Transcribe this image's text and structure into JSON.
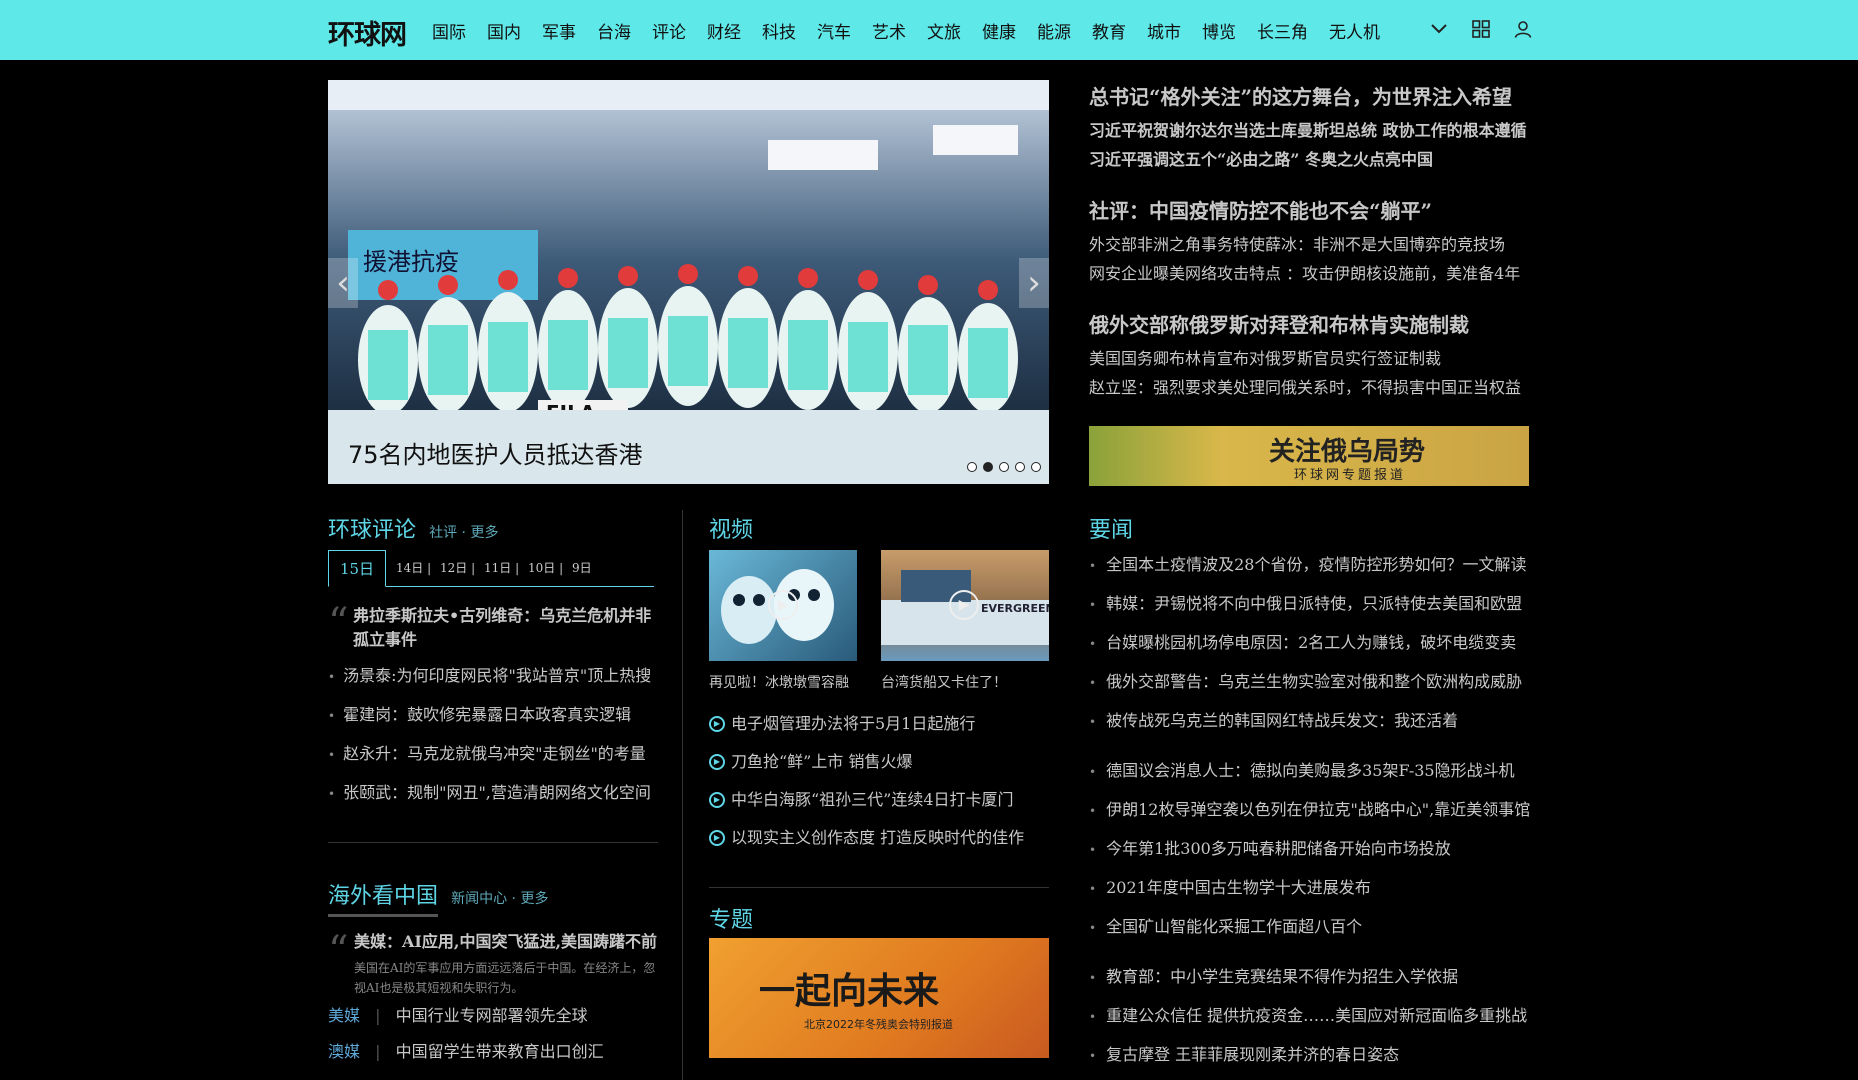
{
  "header": {
    "logo": "环球网",
    "nav": [
      "国际",
      "国内",
      "军事",
      "台海",
      "评论",
      "财经",
      "科技",
      "汽车",
      "艺术",
      "文旅",
      "健康",
      "能源",
      "教育",
      "城市",
      "博览",
      "长三角",
      "无人机"
    ]
  },
  "hero": {
    "caption": "75名内地医护人员抵达香港",
    "sign_text": "援港抗疫",
    "brand_text": "FILA",
    "prev": "‹",
    "next": "›",
    "active_slide": 2,
    "slides": 5
  },
  "headlines": [
    {
      "main": "总书记“格外关注”的这方舞台，为世界注入希望",
      "subs": [
        "习近平祝贺谢尔达尔当选土库曼斯坦总统 政协工作的根本遵循",
        "习近平强调这五个“必由之路” 冬奥之火点亮中国"
      ],
      "bold_subs": true
    },
    {
      "main": "社评：中国疫情防控不能也不会“躺平”",
      "subs": [
        "外交部非洲之角事务特使薛冰：非洲不是大国博弈的竞技场",
        "网安企业曝美网络攻击特点 ：攻击伊朗核设施前，美准备4年"
      ],
      "bold_subs": false
    },
    {
      "main": "俄外交部称俄罗斯对拜登和布林肯实施制裁",
      "subs": [
        "美国国务卿布林肯宣布对俄罗斯官员实行签证制裁",
        "赵立坚：强烈要求美处理同俄关系时，不得损害中国正当权益"
      ],
      "bold_subs": false
    }
  ],
  "banner": {
    "title": "关注俄乌局势",
    "subtitle": "环球网专题报道"
  },
  "commentary": {
    "title": "环球评论",
    "links": "社评 · 更多",
    "tabs": [
      "15日",
      "14日 |",
      "12日 |",
      "11日 |",
      "10日 |",
      "9日"
    ],
    "lead": "弗拉季斯拉夫•古列维奇：乌克兰危机并非孤立事件",
    "items": [
      "汤景泰:为何印度网民将\"我站普京\"顶上热搜",
      "霍建岗：鼓吹修宪暴露日本政客真实逻辑",
      "赵永升：马克龙就俄乌冲突\"走钢丝\"的考量",
      "张颐武：规制\"网丑\",营造清朗网络文化空间"
    ]
  },
  "overseas": {
    "title": "海外看中国",
    "links": "新闻中心 · 更多",
    "lead": "美媒：AI应用,中国突飞猛进,美国踌躇不前",
    "lead_desc": "美国在AI的军事应用方面远远落后于中国。在经济上，忽视AI也是极其短视和失职行为。",
    "rows": [
      {
        "tag": "美媒",
        "text": "中国行业专网部署领先全球"
      },
      {
        "tag": "澳媒",
        "text": "中国留学生带来教育出口创汇"
      }
    ]
  },
  "video": {
    "title": "视频",
    "thumbs": [
      {
        "caption": "再见啦！冰墩墩雪容融"
      },
      {
        "caption": "台湾货船又卡住了！",
        "ship_text": "EVERGREEN"
      }
    ],
    "items": [
      "电子烟管理办法将于5月1日起施行",
      "刀鱼抢“鲜”上市 销售火爆",
      "中华白海豚“祖孙三代”连续4日打卡厦门",
      "以现实主义创作态度 打造反映时代的佳作"
    ],
    "special_title": "专题",
    "special_big": "一起向未来",
    "special_sub": "北京2022年冬残奥会特别报道"
  },
  "news": {
    "title": "要闻",
    "group1": [
      "全国本土疫情波及28个省份，疫情防控形势如何？一文解读",
      "韩媒：尹锡悦将不向中俄日派特使，只派特使去美国和欧盟",
      "台媒曝桃园机场停电原因：2名工人为赚钱，破坏电缆变卖",
      "俄外交部警告：乌克兰生物实验室对俄和整个欧洲构成威胁",
      "被传战死乌克兰的韩国网红特战兵发文：我还活着"
    ],
    "group2": [
      "德国议会消息人士：德拟向美购最多35架F-35隐形战斗机",
      "伊朗12枚导弹空袭以色列在伊拉克\"战略中心\",靠近美领事馆",
      "今年第1批300多万吨春耕肥储备开始向市场投放",
      "2021年度中国古生物学十大进展发布",
      "全国矿山智能化采掘工作面超八百个"
    ],
    "group3": [
      "教育部：中小学生竞赛结果不得作为招生入学依据",
      "重建公众信任 提供抗疫资金……美国应对新冠面临多重挑战",
      "复古摩登 王菲菲展现刚柔并济的春日姿态"
    ]
  },
  "colors": {
    "topbar": "#5ee8e8",
    "accent": "#5ed6e6",
    "background": "#000000"
  }
}
